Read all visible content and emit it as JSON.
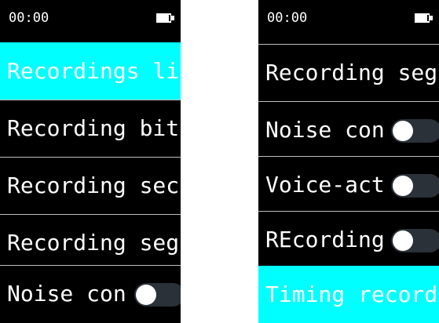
{
  "screens": [
    {
      "status": {
        "time": "00:00",
        "battery_icon": "battery-full-icon"
      },
      "items": [
        {
          "label": "Recordings li",
          "selected": true,
          "toggle": false
        },
        {
          "label": "Recording bit",
          "selected": false,
          "toggle": false
        },
        {
          "label": "Recording sec",
          "selected": false,
          "toggle": false
        },
        {
          "label": "Recording seg",
          "selected": false,
          "toggle": false
        },
        {
          "label": "Noise con",
          "selected": false,
          "toggle": true,
          "toggle_state": "off"
        }
      ]
    },
    {
      "status": {
        "time": "00:00",
        "battery_icon": "battery-full-icon"
      },
      "items": [
        {
          "label": "Recording seg",
          "selected": false,
          "toggle": false
        },
        {
          "label": "Noise con",
          "selected": false,
          "toggle": true,
          "toggle_state": "off"
        },
        {
          "label": "Voice-act",
          "selected": false,
          "toggle": true,
          "toggle_state": "off"
        },
        {
          "label": "REcording",
          "selected": false,
          "toggle": true,
          "toggle_state": "off"
        },
        {
          "label": "Timing record",
          "selected": true,
          "toggle": false
        }
      ]
    }
  ],
  "colors": {
    "selected_background": "#00ffff",
    "background": "#000000",
    "text": "#ffffff",
    "separator": "#bfbfbf",
    "toggle_track": "#2a3138",
    "toggle_knob": "#ffffff"
  }
}
